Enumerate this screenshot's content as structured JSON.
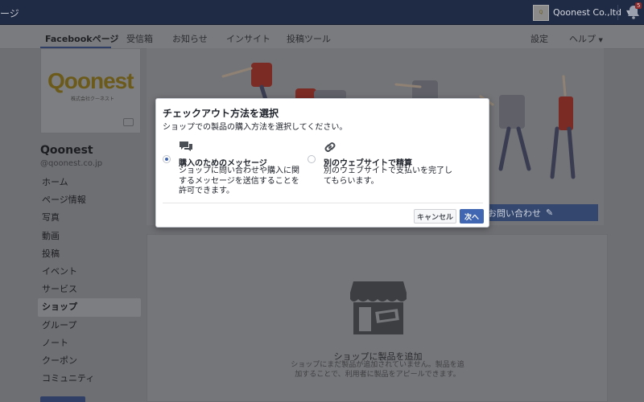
{
  "topbar": {
    "title_fragment": "ージ",
    "account_name": "Qoonest Co.,ltd",
    "notification_count": "5"
  },
  "page_nav": {
    "items": [
      "Facebookページ",
      "受信箱",
      "お知らせ",
      "インサイト",
      "投稿ツール"
    ],
    "settings": "設定",
    "help": "ヘルプ"
  },
  "sidebar": {
    "logo_text": "Qoonest",
    "logo_sub": "株式会社クーネスト",
    "page_name": "Qoonest",
    "handle": "@qoonest.co.jp",
    "menu": [
      "ホーム",
      "ページ情報",
      "写真",
      "動画",
      "投稿",
      "イベント",
      "サービス",
      "ショップ",
      "グループ",
      "ノート",
      "クーポン",
      "コミュニティ"
    ],
    "active_index": 7
  },
  "cover": {
    "contact_button": "お問い合わせ"
  },
  "shop_empty": {
    "title": "ショップに製品を追加",
    "description": "ショップにまだ製品が追加されていません。製品を追加することで、利用者に製品をアピールできます。"
  },
  "modal": {
    "title": "チェックアウト方法を選択",
    "subtitle": "ショップでの製品の購入方法を選択してください。",
    "option_message": {
      "title": "購入のためのメッセージ",
      "description": "ショップに問い合わせや購入に関するメッセージを送信することを許可できます。",
      "selected": true
    },
    "option_website": {
      "title": "別のウェブサイトで精算",
      "description": "別のウェブサイトで支払いを完了してもらいます。",
      "selected": false
    },
    "cancel_label": "キャンセル",
    "next_label": "次へ"
  },
  "colors": {
    "accent": "#4267b2",
    "overlay": "#6e6f73"
  }
}
